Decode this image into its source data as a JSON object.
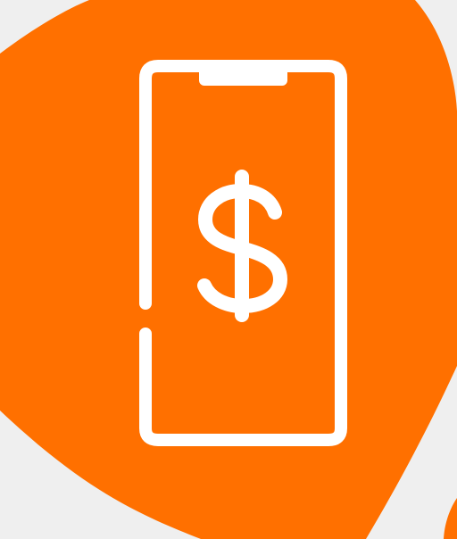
{
  "illustration": {
    "icon": "smartphone-dollar-icon",
    "blob_icon": "orange-blob-shape",
    "colors": {
      "background": "#efefef",
      "blob": "#ff7000",
      "outline": "#ffffff"
    }
  }
}
